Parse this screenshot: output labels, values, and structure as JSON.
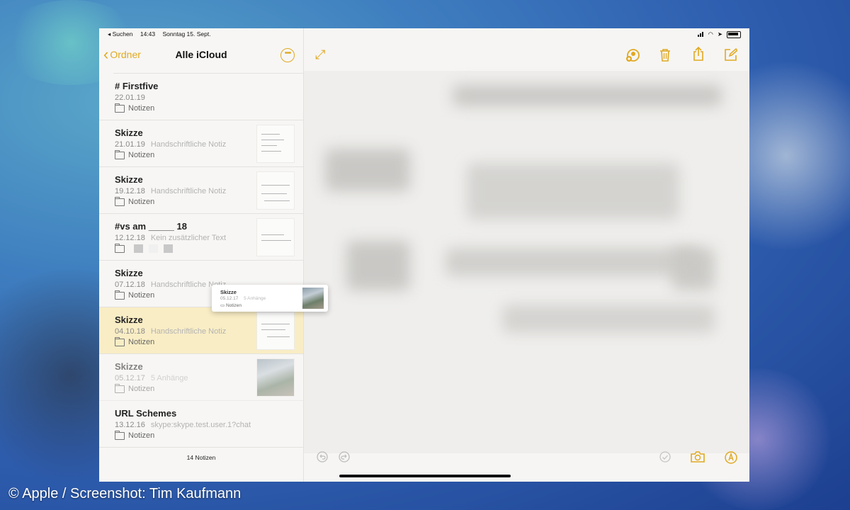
{
  "status_bar": {
    "back_app": "◂ Suchen",
    "time": "14:43",
    "date": "Sonntag 15. Sept."
  },
  "sidebar": {
    "back_label": "Ordner",
    "title": "Alle iCloud",
    "more_icon": "ellipsis-circle-icon",
    "count_label": "14 Notizen"
  },
  "notes": [
    {
      "title": "# Firstfive",
      "date": "22.01.19",
      "subtitle": "",
      "folder": "Notizen"
    },
    {
      "title": "Skizze",
      "date": "21.01.19",
      "subtitle": "Handschriftliche Notiz",
      "folder": "Notizen"
    },
    {
      "title": "Skizze",
      "date": "19.12.18",
      "subtitle": "Handschriftliche Notiz",
      "folder": "Notizen"
    },
    {
      "title": "#vs am _____ 18",
      "date": "12.12.18",
      "subtitle": "Kein zusätzlicher Text",
      "folder": ""
    },
    {
      "title": "Skizze",
      "date": "07.12.18",
      "subtitle": "Handschriftliche Notiz",
      "folder": "Notizen"
    },
    {
      "title": "Skizze",
      "date": "04.10.18",
      "subtitle": "Handschriftliche Notiz",
      "folder": "Notizen"
    },
    {
      "title": "Skizze",
      "date": "05.12.17",
      "subtitle": "5 Anhänge",
      "folder": "Notizen"
    },
    {
      "title": "URL Schemes",
      "date": "13.12.16",
      "subtitle": "skype:skype.test.user.1?chat",
      "folder": "Notizen"
    }
  ],
  "drag_preview": {
    "title": "Skizze",
    "date": "05.12.17",
    "subtitle": "5 Anhänge",
    "folder": "Notizen"
  },
  "toolbar_icons": [
    "expand-icon",
    "add-person-icon",
    "trash-icon",
    "share-icon",
    "compose-icon"
  ],
  "bottom_icons": [
    "undo-icon",
    "redo-icon",
    "checklist-icon",
    "camera-icon",
    "markup-icon"
  ],
  "credit": "© Apple / Screenshot: Tim Kaufmann",
  "colors": {
    "accent": "#e0a922",
    "selected_row": "#f9edc5"
  }
}
